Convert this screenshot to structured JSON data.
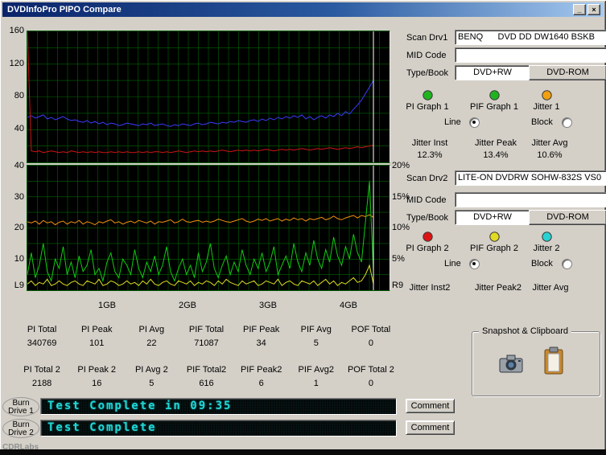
{
  "window": {
    "title": "DVDInfoPro PIPO Compare",
    "minimize_glyph": "_",
    "close_glyph": "×"
  },
  "watermark": "CDRLabs",
  "drive1": {
    "scan_label": "Scan Drv1",
    "scan_value": "BENQ      DVD DD DW1640 BSKB",
    "mid_label": "MID Code",
    "mid_value": "",
    "type_label": "Type/Book",
    "type_value": "DVD+RW",
    "book_value": "DVD-ROM",
    "legend": [
      {
        "label": "PI Graph 1",
        "color": "#1fb41f"
      },
      {
        "label": "PIF Graph 1",
        "color": "#1fb41f"
      },
      {
        "label": "Jitter 1",
        "color": "#f0a010"
      }
    ],
    "line_label": "Line",
    "block_label": "Block",
    "jitter_labels": [
      "Jitter Inst",
      "Jitter Peak",
      "Jitter Avg"
    ],
    "jitter_values": [
      "12.3%",
      "13.4%",
      "10.6%"
    ]
  },
  "drive2": {
    "scan_label": "Scan Drv2",
    "scan_value": "LITE-ON DVDRW SOHW-832S VS0",
    "mid_label": "MID Code",
    "mid_value": "",
    "type_label": "Type/Book",
    "type_value": "DVD+RW",
    "book_value": "DVD-ROM",
    "legend": [
      {
        "label": "PI Graph 2",
        "color": "#dd1414"
      },
      {
        "label": "PIF Graph 2",
        "color": "#e2da22"
      },
      {
        "label": "Jitter 2",
        "color": "#28d2d2"
      }
    ],
    "line_label": "Line",
    "block_label": "Block",
    "jitter_labels": [
      "Jitter Inst2",
      "Jitter Peak2",
      "Jitter Avg"
    ],
    "jitter_values": [
      "",
      "",
      ""
    ]
  },
  "stats_row1": [
    {
      "label": "PI Total",
      "value": "340769"
    },
    {
      "label": "PI Peak",
      "value": "101"
    },
    {
      "label": "PI Avg",
      "value": "22"
    },
    {
      "label": "PIF Total",
      "value": "71087"
    },
    {
      "label": "PIF Peak",
      "value": "34"
    },
    {
      "label": "PIF Avg",
      "value": "5"
    },
    {
      "label": "POF Total",
      "value": "0"
    }
  ],
  "stats_row2": [
    {
      "label": "PI Total 2",
      "value": "2188"
    },
    {
      "label": "PI Peak 2",
      "value": "16"
    },
    {
      "label": "PI Avg 2",
      "value": "5"
    },
    {
      "label": "PIF Total2",
      "value": "616"
    },
    {
      "label": "PIF Peak2",
      "value": "6"
    },
    {
      "label": "PIF Avg2",
      "value": "1"
    },
    {
      "label": "POF Total 2",
      "value": "0"
    }
  ],
  "snapshot": {
    "title": "Snapshot & Clipboard"
  },
  "burn1": {
    "label_line1": "Burn",
    "label_line2": "Drive 1",
    "display": "Test Complete in 09:35",
    "button": "Comment"
  },
  "burn2": {
    "label_line1": "Burn",
    "label_line2": "Drive 2",
    "display": "Test Complete",
    "button": "Comment"
  },
  "chart_data": [
    {
      "type": "line",
      "x_range": [
        0,
        4.5
      ],
      "x_unit": "GB",
      "x_tick_values": [
        1,
        2,
        3,
        4
      ],
      "x_tick_labels": [
        "1GB",
        "2GB",
        "3GB",
        "4GB"
      ],
      "y_range": [
        0,
        160
      ],
      "y_tick_labels": [
        "160",
        "120",
        "80",
        "40"
      ],
      "grid": {
        "v_lines": 36,
        "h_lines": 8,
        "color": "#006600"
      },
      "background": "#000000",
      "cursor_x": 4.3,
      "cursor_color": "#ffffff",
      "series": [
        {
          "name": "pi-drive1",
          "color": "#3a3aff",
          "values": [
            55,
            57,
            54,
            56,
            58,
            53,
            55,
            52,
            54,
            56,
            53,
            51,
            52,
            50,
            49,
            51,
            48,
            50,
            47,
            49,
            46,
            48,
            47,
            45,
            46,
            48,
            47,
            46,
            45,
            47,
            46,
            48,
            45,
            46,
            47,
            45,
            44,
            46,
            45,
            47,
            46,
            45,
            47,
            48,
            46,
            47,
            49,
            48,
            47,
            49,
            48,
            50,
            49,
            51,
            50,
            49,
            51,
            52,
            50,
            53,
            51,
            54,
            52,
            55,
            53,
            56,
            54,
            57,
            55,
            58,
            53,
            56,
            52,
            55,
            57,
            54,
            58,
            56,
            60,
            57,
            62,
            59,
            65,
            70,
            76,
            84,
            92,
            100
          ]
        },
        {
          "name": "pi-drive2",
          "color": "#cc1414",
          "values": [
            160,
            14,
            13,
            14,
            12,
            13,
            14,
            13,
            12,
            13,
            12,
            14,
            13,
            12,
            13,
            12,
            13,
            12,
            13,
            12,
            12,
            13,
            12,
            13,
            12,
            13,
            12,
            12,
            13,
            12,
            13,
            12,
            13,
            13,
            12,
            13,
            12,
            13,
            14,
            13,
            12,
            13,
            14,
            13,
            14,
            13,
            14,
            13,
            14,
            15,
            14,
            13,
            14,
            15,
            14,
            15,
            14,
            15,
            14,
            15,
            16,
            15,
            14,
            15,
            16,
            15,
            16,
            15,
            16,
            17,
            16,
            15,
            16,
            17,
            16,
            17,
            18,
            17,
            16,
            17,
            18,
            17,
            18,
            19,
            18,
            19,
            20,
            21
          ]
        }
      ]
    },
    {
      "type": "line",
      "x_range": [
        0,
        4.5
      ],
      "x_unit": "GB",
      "x_tick_values": [
        1,
        2,
        3,
        4
      ],
      "x_tick_labels": [
        "1GB",
        "2GB",
        "3GB",
        "4GB"
      ],
      "y_range": [
        0,
        40
      ],
      "y_tick_labels": [
        "40",
        "30",
        "20",
        "10"
      ],
      "y_right_range": [
        0,
        20
      ],
      "y_right_tick_labels": [
        "20%",
        "15%",
        "10%",
        "5%"
      ],
      "corner_label_left": "L9",
      "corner_label_right": "R9",
      "grid": {
        "v_lines": 36,
        "h_lines": 8,
        "color": "#006600"
      },
      "background": "#000000",
      "cursor_x": 4.3,
      "cursor_color": "#ffffff",
      "series": [
        {
          "name": "jitter-drive1",
          "axis": "right",
          "color": "#f09010",
          "values": [
            11.0,
            10.8,
            11.1,
            10.6,
            11.2,
            10.8,
            11.0,
            10.5,
            10.9,
            11.1,
            10.6,
            11.0,
            10.8,
            11.2,
            10.6,
            11.0,
            10.8,
            10.5,
            11.0,
            10.8,
            11.1,
            11.3,
            10.8,
            11.0,
            10.6,
            10.9,
            11.1,
            10.8,
            11.2,
            11.0,
            10.8,
            11.1,
            10.6,
            11.0,
            10.9,
            11.1,
            11.3,
            10.8,
            11.0,
            11.4,
            11.0,
            10.9,
            11.1,
            11.2,
            10.9,
            11.1,
            10.9,
            11.1,
            11.4,
            11.2,
            11.0,
            10.9,
            11.1,
            11.3,
            11.5,
            11.1,
            10.9,
            11.1,
            11.4,
            11.2,
            11.5,
            11.1,
            11.3,
            11.5,
            11.1,
            11.4,
            11.2,
            11.6,
            11.3,
            11.5,
            11.1,
            11.5,
            11.3,
            11.5,
            11.7,
            11.3,
            11.5,
            11.9,
            11.5,
            11.3,
            11.6,
            11.8,
            12.0,
            11.6,
            12.0,
            11.8,
            12.1,
            11.7
          ]
        },
        {
          "name": "pif-drive1",
          "color": "#10cc10",
          "values": [
            5,
            12,
            4,
            8,
            15,
            6,
            3,
            10,
            7,
            14,
            5,
            9,
            4,
            11,
            6,
            8,
            13,
            5,
            7,
            3,
            9,
            12,
            6,
            4,
            10,
            8,
            5,
            13,
            7,
            4,
            9,
            6,
            11,
            5,
            8,
            14,
            6,
            3,
            7,
            10,
            5,
            8,
            4,
            12,
            6,
            9,
            15,
            7,
            4,
            8,
            11,
            5,
            9,
            6,
            13,
            8,
            5,
            10,
            7,
            12,
            6,
            9,
            14,
            5,
            8,
            11,
            7,
            15,
            9,
            6,
            12,
            8,
            16,
            10,
            7,
            13,
            9,
            17,
            11,
            8,
            14,
            10,
            18,
            12,
            9,
            22,
            35,
            6
          ]
        },
        {
          "name": "pif-drive2",
          "color": "#dede20",
          "values": [
            2,
            3,
            1.5,
            2.5,
            2,
            3.5,
            1.5,
            2,
            3,
            2,
            1.5,
            2.5,
            3,
            2,
            1.5,
            3,
            2.5,
            2,
            3.5,
            1.5,
            2,
            3,
            2.5,
            1.5,
            2,
            3,
            2,
            2.5,
            1.5,
            3,
            2,
            3.5,
            2,
            1.5,
            2.5,
            3,
            2,
            1.5,
            3,
            2.5,
            2,
            3,
            1.5,
            2.5,
            2,
            3,
            2.5,
            1.5,
            3,
            2,
            3.5,
            2.5,
            2,
            1.5,
            3,
            2,
            2.5,
            3,
            1.5,
            2,
            3,
            2.5,
            2,
            3.5,
            1.5,
            2.5,
            3,
            2,
            1.5,
            3,
            2.5,
            2,
            3,
            1.5,
            2.5,
            3.5,
            2,
            3,
            1.5,
            2.5,
            2,
            3,
            4,
            2.5,
            3,
            5,
            8,
            2
          ]
        }
      ]
    }
  ]
}
